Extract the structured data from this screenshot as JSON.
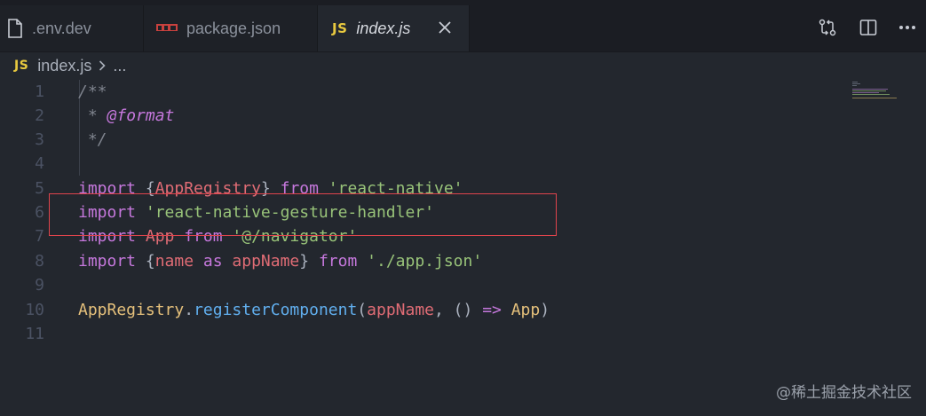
{
  "tabs": [
    {
      "label": ".env.dev",
      "icon": "file-icon",
      "active": false
    },
    {
      "label": "package.json",
      "icon": "npm-icon",
      "active": false
    },
    {
      "label": "index.js",
      "icon": "js-icon",
      "active": true,
      "badge": "JS"
    }
  ],
  "breadcrumb": {
    "badge": "JS",
    "file": "index.js",
    "more": "..."
  },
  "editor": {
    "line_numbers": [
      "1",
      "2",
      "3",
      "4",
      "5",
      "6",
      "7",
      "8",
      "9",
      "10",
      "11"
    ],
    "lines": [
      [
        {
          "t": "/**",
          "c": "comment"
        }
      ],
      [
        {
          "t": " * ",
          "c": "comment"
        },
        {
          "t": "@format",
          "c": "tag"
        }
      ],
      [
        {
          "t": " */",
          "c": "comment"
        }
      ],
      [],
      [
        {
          "t": "import ",
          "c": "kw"
        },
        {
          "t": "{",
          "c": "punc"
        },
        {
          "t": "AppRegistry",
          "c": "var"
        },
        {
          "t": "} ",
          "c": "punc"
        },
        {
          "t": "from ",
          "c": "kw"
        },
        {
          "t": "'react-native'",
          "c": "str"
        }
      ],
      [
        {
          "t": "import ",
          "c": "kw"
        },
        {
          "t": "'react-native-gesture-handler'",
          "c": "str"
        }
      ],
      [
        {
          "t": "import ",
          "c": "kw"
        },
        {
          "t": "App ",
          "c": "var"
        },
        {
          "t": "from ",
          "c": "kw"
        },
        {
          "t": "'@/navigator'",
          "c": "str"
        }
      ],
      [
        {
          "t": "import ",
          "c": "kw"
        },
        {
          "t": "{",
          "c": "punc"
        },
        {
          "t": "name ",
          "c": "var"
        },
        {
          "t": "as ",
          "c": "kw"
        },
        {
          "t": "appName",
          "c": "var"
        },
        {
          "t": "} ",
          "c": "punc"
        },
        {
          "t": "from ",
          "c": "kw"
        },
        {
          "t": "'./app.json'",
          "c": "str"
        }
      ],
      [],
      [
        {
          "t": "AppRegistry",
          "c": "id"
        },
        {
          "t": ".",
          "c": "punc"
        },
        {
          "t": "registerComponent",
          "c": "fn"
        },
        {
          "t": "(",
          "c": "punc"
        },
        {
          "t": "appName",
          "c": "var"
        },
        {
          "t": ", () ",
          "c": "punc"
        },
        {
          "t": "=>",
          "c": "kw"
        },
        {
          "t": " ",
          "c": "punc"
        },
        {
          "t": "App",
          "c": "id"
        },
        {
          "t": ")",
          "c": "punc"
        }
      ],
      []
    ]
  },
  "watermark": "@稀土掘金技术社区",
  "colors": {
    "background": "#23272e",
    "tabbar": "#1b1d23",
    "highlight_border": "#e0444c"
  }
}
